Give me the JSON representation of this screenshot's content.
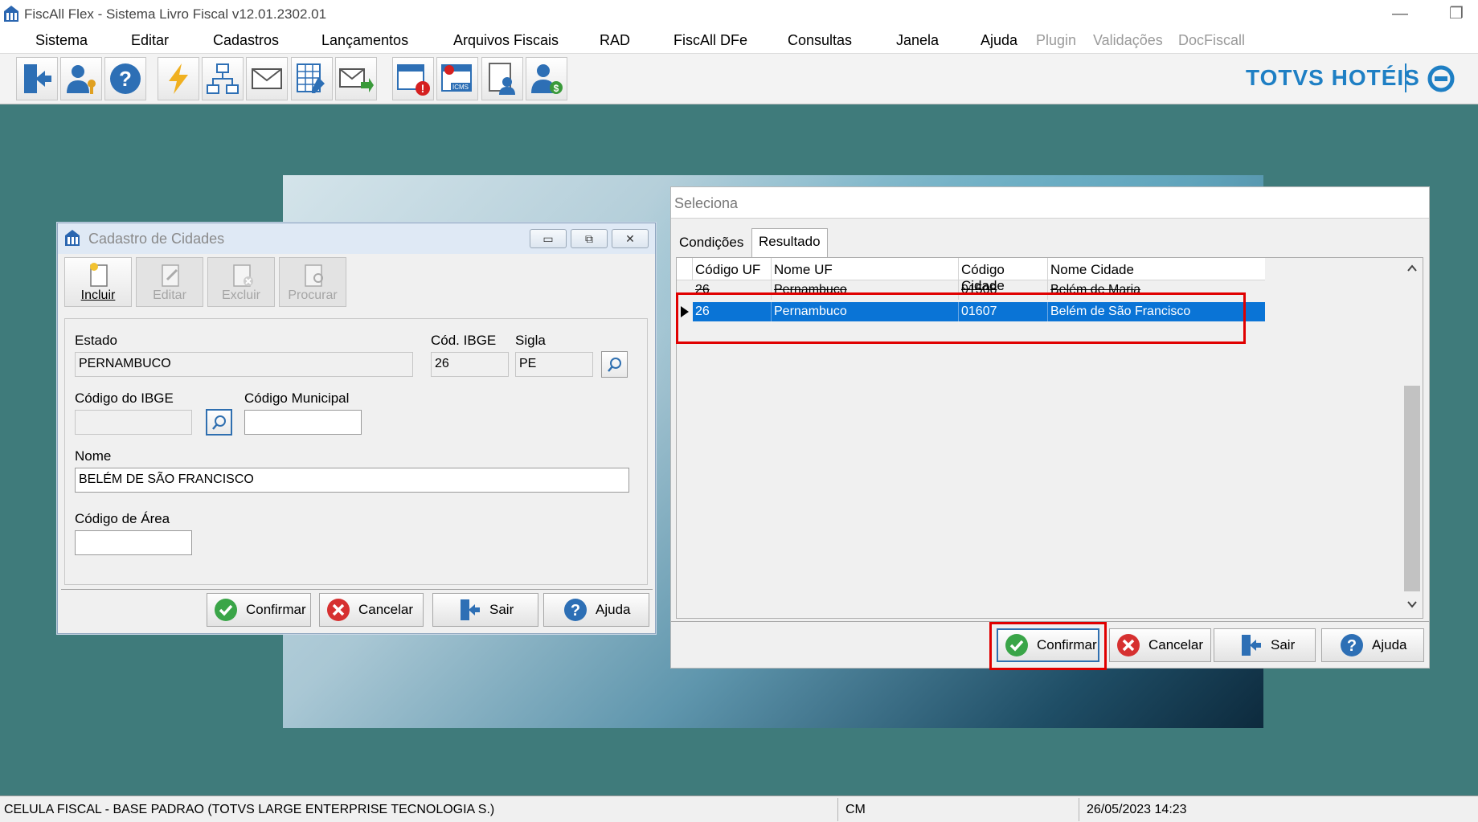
{
  "app": {
    "title": "FiscAll Flex - Sistema Livro Fiscal v12.01.2302.01",
    "brand": "TOTVS HOTÉIS"
  },
  "menu": [
    {
      "label": "Sistema",
      "enabled": true
    },
    {
      "label": "Editar",
      "enabled": true
    },
    {
      "label": "Cadastros",
      "enabled": true
    },
    {
      "label": "Lançamentos",
      "enabled": true
    },
    {
      "label": "Arquivos Fiscais",
      "enabled": true
    },
    {
      "label": "RAD",
      "enabled": true
    },
    {
      "label": "FiscAll DFe",
      "enabled": true
    },
    {
      "label": "Consultas",
      "enabled": true
    },
    {
      "label": "Janela",
      "enabled": true
    },
    {
      "label": "Ajuda",
      "enabled": true
    },
    {
      "label": "Plugin",
      "enabled": false
    },
    {
      "label": "Validações",
      "enabled": false
    },
    {
      "label": "DocFiscall",
      "enabled": false
    }
  ],
  "toolbar_icons": [
    "exit-icon",
    "user-key-icon",
    "help-icon",
    "lightning-icon",
    "network-icon",
    "mail-icon",
    "spreadsheet-edit-icon",
    "mail-send-icon",
    "calendar-alert-icon",
    "icms-calendar-icon",
    "document-user-icon",
    "user-money-icon"
  ],
  "cadastro": {
    "title": "Cadastro de Cidades",
    "toolbar": [
      {
        "label": "Incluir",
        "enabled": true
      },
      {
        "label": "Editar",
        "enabled": false
      },
      {
        "label": "Excluir",
        "enabled": false
      },
      {
        "label": "Procurar",
        "enabled": false
      }
    ],
    "fields": {
      "estado_label": "Estado",
      "estado_value": "PERNAMBUCO",
      "cod_ibge_label": "Cód. IBGE",
      "cod_ibge_value": "26",
      "sigla_label": "Sigla",
      "sigla_value": "PE",
      "codigo_ibge_label": "Código do IBGE",
      "codigo_ibge_value": "",
      "codigo_municipal_label": "Código Municipal",
      "codigo_municipal_value": "",
      "nome_label": "Nome",
      "nome_value": "BELÉM DE SÃO FRANCISCO",
      "codigo_area_label": "Código de Área",
      "codigo_area_value": ""
    },
    "buttons": {
      "confirmar": "Confirmar",
      "cancelar": "Cancelar",
      "sair": "Sair",
      "ajuda": "Ajuda"
    }
  },
  "seleciona": {
    "title": "Seleciona",
    "tabs": [
      "Condições",
      "Resultado"
    ],
    "active_tab": "Resultado",
    "columns": [
      "Código UF",
      "Nome UF",
      "Código Cidade",
      "Nome Cidade"
    ],
    "rows": [
      [
        "26",
        "Pernambuco",
        "01508",
        "Belém de Maria"
      ],
      [
        "26",
        "Pernambuco",
        "01607",
        "Belém de São Francisco"
      ]
    ],
    "selected_row": 1,
    "buttons": {
      "confirmar": "Confirmar",
      "cancelar": "Cancelar",
      "sair": "Sair",
      "ajuda": "Ajuda"
    }
  },
  "status": {
    "company": "CELULA FISCAL - BASE PADRAO (TOTVS LARGE ENTERPRISE TECNOLOGIA S.)",
    "module": "CM",
    "datetime": "26/05/2023 14:23"
  },
  "colors": {
    "workspace": "#3f7b7b",
    "selection": "#0a74d6",
    "highlight": "#e00000",
    "brand": "#1e7fc4"
  }
}
